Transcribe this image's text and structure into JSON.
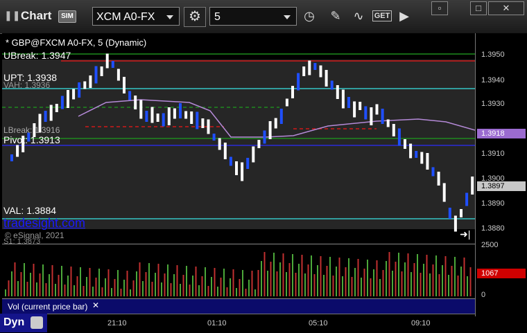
{
  "toolbar": {
    "title": "Chart",
    "sim_badge": "SIM",
    "symbol": "XCM A0-FX",
    "interval": "5",
    "settings_icon": "gear-icon",
    "time_icon": "clock-icon",
    "draw_icon": "pencil-icon",
    "study_icon": "study-icon",
    "get_icon": "get-icon",
    "play_icon": "play-icon",
    "get_label": "GET",
    "win_min": "▫",
    "win_max": "□",
    "win_close": "✕"
  },
  "chart": {
    "symbol_label": "* GBP@FXCM A0-FX, 5 (Dynamic)",
    "labels": {
      "ubreak": "UBreak: 1.3947",
      "upt": "UPT: 1.3938",
      "vah": "VAH: 1.3936",
      "lbreak": "LBreak: 1.3916",
      "pivot": "Pivot: 1.3913",
      "val": "VAL: 1.3884",
      "s1": "S1: 1.3873"
    },
    "watermark": "tradesight.com",
    "copyright": "© eSignal, 2021",
    "price_ticks": [
      "1.3950",
      "1.3940",
      "1.3930",
      "1.3910",
      "1.3900",
      "1.3890",
      "1.3880"
    ],
    "price_tag_ma": "1.3918",
    "price_tag_last": "1.3897",
    "volume_ticks": [
      "2500",
      "0"
    ],
    "volume_tag": "1067",
    "volume_label": "Vol (current price bar)",
    "volume_close": "✕",
    "time_labels": [
      "21:10",
      "01:10",
      "05:10",
      "09:10"
    ],
    "dyn_label": "Dyn",
    "colors": {
      "up": "#ffffff",
      "down": "#1f4fff",
      "ma": "#b58ad8",
      "level_green": "#1e8a1e",
      "level_red": "#d01818",
      "level_cyan": "#35c6c6",
      "level_blue": "#2b2bd8",
      "vol_up": "#4ca83a",
      "vol_down": "#c23030",
      "ma_tag": "#9b6bd0",
      "vol_tag": "#d00000"
    }
  }
}
